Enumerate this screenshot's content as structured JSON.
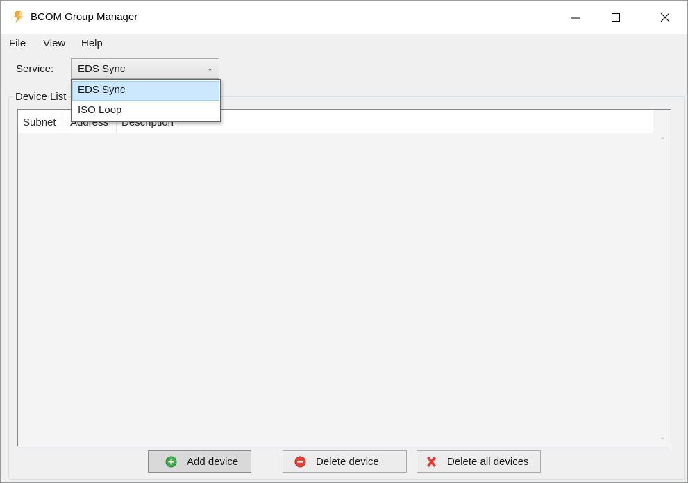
{
  "window": {
    "title": "BCOM Group Manager"
  },
  "menu": {
    "file": "File",
    "view": "View",
    "help": "Help"
  },
  "service": {
    "label": "Service:",
    "selected": "EDS Sync",
    "options": [
      "EDS Sync",
      "ISO Loop"
    ]
  },
  "device_list": {
    "group_label": "Device List",
    "columns": [
      "Subnet",
      "Address",
      "Description"
    ],
    "rows": []
  },
  "buttons": {
    "add": "Add device",
    "delete": "Delete device",
    "delete_all": "Delete all devices"
  },
  "icons": {
    "app": "lightning-icon",
    "add": "plus-circle-icon",
    "delete": "minus-circle-icon",
    "delete_all": "red-x-icon"
  },
  "colors": {
    "add_icon": "#3fae49",
    "delete_icon": "#e0443a",
    "delete_all_icon": "#e53935",
    "app_icon": "#f0a830",
    "selection": "#cce8ff"
  }
}
